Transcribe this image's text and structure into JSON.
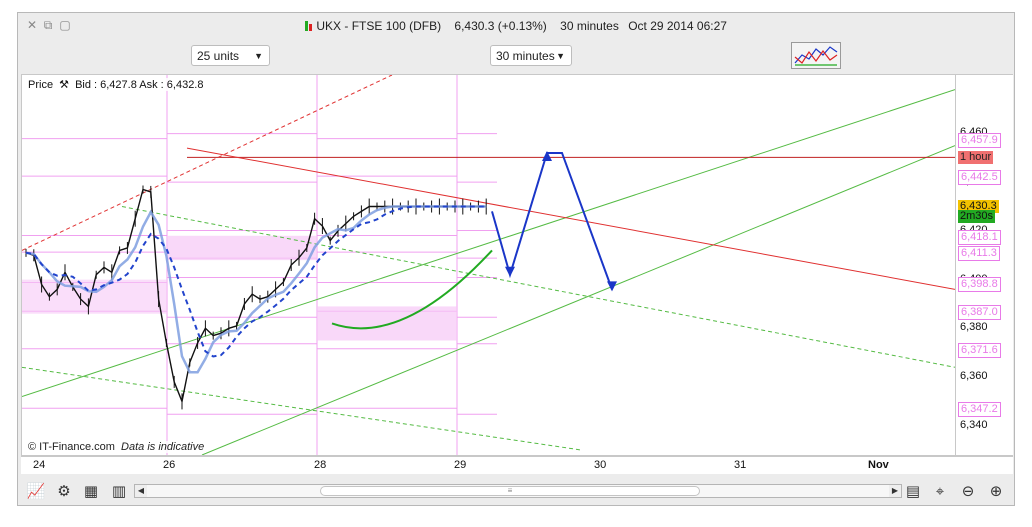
{
  "window": {
    "title": "UKX - FTSE 100 (DFB)",
    "quote": "6,430.3 (+0.13%)",
    "interval_label": "30 minutes",
    "datetime": "Oct 29 2014 06:27"
  },
  "controls": {
    "units_select": "25 units",
    "interval_select": "30 minutes"
  },
  "legend": {
    "label": "Price",
    "bid_ask": "Bid : 6,427.8 Ask : 6,432.8"
  },
  "credit": {
    "source": "© IT-Finance.com",
    "note": "Data is indicative"
  },
  "colors": {
    "price_box": "#f2c200",
    "timer_box": "#22aa22",
    "hour_box": "#f07070",
    "pivot_text": "#e87ae8",
    "resistance": "#e03030",
    "channel": "#55bb44",
    "projection": "#1a36c8",
    "ma_light": "#7f9fe0"
  },
  "chart_data": {
    "type": "line",
    "title": "UKX - FTSE 100 (DFB)",
    "x_ticks": [
      "24",
      "26",
      "28",
      "29",
      "30",
      "31",
      "Nov"
    ],
    "y_ticks": [
      "6,460",
      "6,440",
      "6,420",
      "6,400",
      "6,380",
      "6,360",
      "6,340"
    ],
    "ylim": [
      6328,
      6484
    ],
    "grid": false,
    "price_series": {
      "name": "Price",
      "x": [
        0,
        2,
        4,
        6,
        8,
        10,
        12,
        14,
        16,
        18,
        20,
        22,
        24,
        26,
        28,
        30,
        32,
        34,
        36,
        38,
        40,
        42,
        44,
        46,
        48,
        50,
        52,
        54,
        56,
        58,
        60,
        62,
        64,
        66,
        68,
        70,
        72,
        74,
        76,
        78,
        80,
        82,
        84,
        86,
        88,
        90,
        92,
        94,
        96,
        98,
        100,
        102,
        104,
        106,
        108,
        110,
        112,
        114,
        116,
        118,
        120
      ],
      "values": [
        6411,
        6410,
        6398,
        6393,
        6396,
        6403,
        6397,
        6392,
        6389,
        6402,
        6405,
        6403,
        6412,
        6413,
        6425,
        6437,
        6436,
        6392,
        6374,
        6358,
        6350,
        6366,
        6374,
        6380,
        6377,
        6378,
        6380,
        6381,
        6390,
        6394,
        6392,
        6393,
        6396,
        6399,
        6406,
        6409,
        6413,
        6425,
        6422,
        6416,
        6420,
        6423,
        6426,
        6428,
        6430,
        6430,
        6430,
        6430,
        6430,
        6430,
        6430,
        6430,
        6430,
        6430,
        6430,
        6430,
        6430,
        6430,
        6430,
        6430,
        6430
      ]
    },
    "pivot_levels": [
      "6,457.9",
      "6,442.5",
      "6,418.1",
      "6,411.3",
      "6,398.8",
      "6,387.0",
      "6,371.6",
      "6,347.2"
    ],
    "price_box": "6,430.3",
    "timer_box": "2m30s",
    "hour_box": "1 hour",
    "resistance_level": 6450.2,
    "annotations": [
      "Horizontal resistance line",
      "Descending resistance line",
      "Ascending green channel",
      "Blue zig-zag projection arrows"
    ]
  },
  "toolbar": {
    "icons": [
      "chart-tool-icon",
      "indicator-icon",
      "calculator-icon",
      "grid-icon",
      "scroll-left-icon",
      "scroll-right-icon",
      "bars-icon",
      "zoom-fit-icon",
      "zoom-out-icon",
      "zoom-in-icon"
    ]
  }
}
